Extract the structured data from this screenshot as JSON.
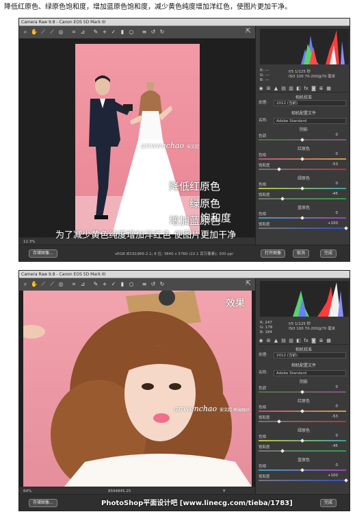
{
  "caption": "降低红原色、绿原色饱和度，增加蓝原色饱和度，减少黄色纯度增加洋红色，使图片更加干净。",
  "window1": {
    "title": "Camera Raw 9.8  -  Canon EOS 5D Mark III",
    "zoom": "12.3%",
    "status": "sRGB IEC61966-2.1; 8 位; 3840 x 5760 (22.1 百万像素); 300 ppi",
    "buttons": {
      "save": "存储图像...",
      "open": "打开图像",
      "cancel": "取消",
      "done": "完成"
    },
    "readout": {
      "r": "R: ---",
      "g": "G: ---",
      "b": "B: ---",
      "exif1": "f/5    1/125 秒",
      "exif2": "ISO 100   70-200@70 毫米"
    },
    "overlay": [
      "降低红原色",
      "绿原色",
      "增加蓝原色",
      "饱和度",
      "为了减少黄色纯度增加洋红色 使图片更加干净"
    ]
  },
  "window2": {
    "title": "Camera Raw 9.8  -  Canon EOS 5D Mark III",
    "zoom": "64%",
    "status": "8594845.25",
    "readout": {
      "r": "R: 247",
      "g": "G: 178",
      "b": "B: 184",
      "exif1": "f/5    1/125 秒",
      "exif2": "ISO 100   70-200@70 毫米"
    },
    "effect_label": "效果",
    "banner": "PhotoShop平面设计吧 [www.linecg.com/tieba/1783]",
    "buttons": {
      "save": "存储图像...",
      "done": "完成"
    }
  },
  "watermark": {
    "main": "anwenchao",
    "sub": "安文超 高端婚纱"
  },
  "panel": {
    "title": "相机校准",
    "process_label": "处理:",
    "process_value": "2012 (当前)",
    "profile_section": "相机配置文件",
    "name_label": "名称:",
    "profile_value": "Adobe Standard",
    "sections": [
      {
        "title": "阴影",
        "sliders": [
          {
            "label": "色调",
            "value": "0",
            "pos": 0.5
          }
        ]
      },
      {
        "title": "红原色",
        "sliders": [
          {
            "label": "色相",
            "value": "0",
            "pos": 0.5
          },
          {
            "label": "饱和度",
            "value": "-53",
            "pos": 0.235
          }
        ]
      },
      {
        "title": "绿原色",
        "sliders": [
          {
            "label": "色相",
            "value": "0",
            "pos": 0.5
          },
          {
            "label": "饱和度",
            "value": "-45",
            "pos": 0.275
          }
        ]
      },
      {
        "title": "蓝原色",
        "sliders": [
          {
            "label": "色相",
            "value": "0",
            "pos": 0.5
          },
          {
            "label": "饱和度",
            "value": "+100",
            "pos": 1.0
          }
        ]
      }
    ]
  },
  "colors": {
    "window_bg": "#3c3c3c",
    "panel_bg": "#3a3a3a",
    "pink_bg": "#f29aa6"
  }
}
